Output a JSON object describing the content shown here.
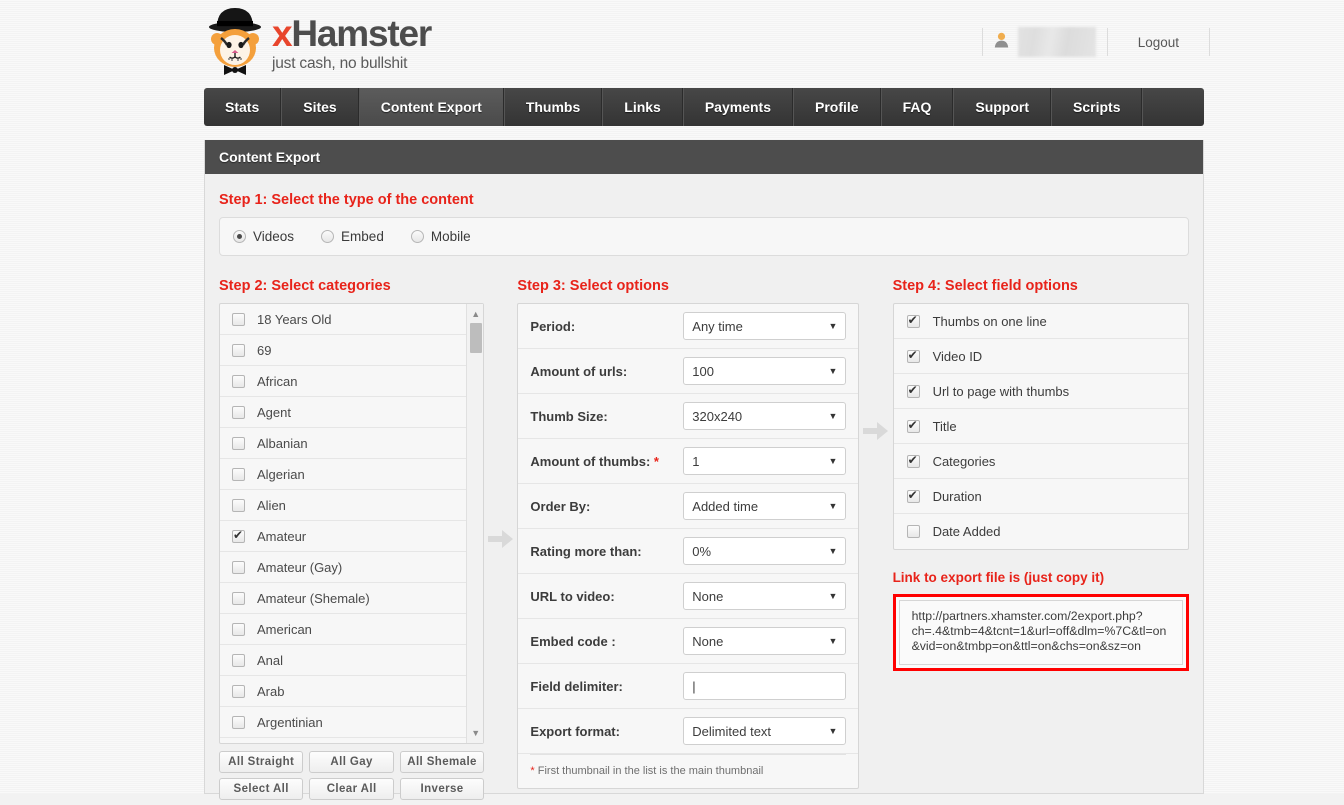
{
  "brand": {
    "name_x": "x",
    "name_rest": "Hamster",
    "tagline": "just cash, no bullshit",
    "logo_icon": "hamster-in-tophat-icon",
    "accent_color": "#e8452c"
  },
  "header": {
    "user_icon": "user-avatar-icon",
    "username": "",
    "logout_label": "Logout"
  },
  "nav": {
    "items": [
      {
        "label": "Stats",
        "active": false
      },
      {
        "label": "Sites",
        "active": false
      },
      {
        "label": "Content Export",
        "active": true
      },
      {
        "label": "Thumbs",
        "active": false
      },
      {
        "label": "Links",
        "active": false
      },
      {
        "label": "Payments",
        "active": false
      },
      {
        "label": "Profile",
        "active": false
      },
      {
        "label": "FAQ",
        "active": false
      },
      {
        "label": "Support",
        "active": false
      },
      {
        "label": "Scripts",
        "active": false
      }
    ]
  },
  "panel": {
    "title": "Content Export"
  },
  "step1": {
    "label": "Step 1:  Select the type of the content",
    "options": [
      {
        "label": "Videos",
        "checked": true
      },
      {
        "label": "Embed",
        "checked": false
      },
      {
        "label": "Mobile",
        "checked": false
      }
    ]
  },
  "step2": {
    "label": "Step 2:  Select categories",
    "categories": [
      {
        "label": "18 Years Old",
        "checked": false
      },
      {
        "label": "69",
        "checked": false
      },
      {
        "label": "African",
        "checked": false
      },
      {
        "label": "Agent",
        "checked": false
      },
      {
        "label": "Albanian",
        "checked": false
      },
      {
        "label": "Algerian",
        "checked": false
      },
      {
        "label": "Alien",
        "checked": false
      },
      {
        "label": "Amateur",
        "checked": true
      },
      {
        "label": "Amateur (Gay)",
        "checked": false
      },
      {
        "label": "Amateur (Shemale)",
        "checked": false
      },
      {
        "label": "American",
        "checked": false
      },
      {
        "label": "Anal",
        "checked": false
      },
      {
        "label": "Arab",
        "checked": false
      },
      {
        "label": "Argentinian",
        "checked": false
      }
    ],
    "buttons_row1": [
      "All Straight",
      "All Gay",
      "All Shemale"
    ],
    "buttons_row2": [
      "Select All",
      "Clear All",
      "Inverse"
    ],
    "scroll_up_icon": "scroll-up-arrow-icon",
    "scroll_down_icon": "scroll-down-arrow-icon"
  },
  "arrow_icon": "arrow-right-icon",
  "step3": {
    "label": "Step 3:  Select options",
    "rows": [
      {
        "label": "Period:",
        "value": "Any time",
        "type": "select",
        "required": false
      },
      {
        "label": "Amount of urls:",
        "value": "100",
        "type": "select",
        "required": false
      },
      {
        "label": "Thumb Size:",
        "value": "320x240",
        "type": "select",
        "required": false
      },
      {
        "label": "Amount of thumbs:",
        "value": "1",
        "type": "select",
        "required": true
      },
      {
        "label": "Order By:",
        "value": "Added time",
        "type": "select",
        "required": false
      },
      {
        "label": "Rating more than:",
        "value": "0%",
        "type": "select",
        "required": false
      },
      {
        "label": "URL to video:",
        "value": "None",
        "type": "select",
        "required": false
      },
      {
        "label": "Embed code :",
        "value": "None",
        "type": "select",
        "required": false
      },
      {
        "label": "Field delimiter:",
        "value": "|",
        "type": "text",
        "required": false
      },
      {
        "label": "Export format:",
        "value": "Delimited text",
        "type": "select",
        "required": false
      }
    ],
    "note_star": "*",
    "note": " First thumbnail in the list is the main thumbnail"
  },
  "step4": {
    "label": "Step 4:  Select field options",
    "fields": [
      {
        "label": "Thumbs on one line",
        "checked": true
      },
      {
        "label": "Video ID",
        "checked": true
      },
      {
        "label": "Url to page with thumbs",
        "checked": true
      },
      {
        "label": "Title",
        "checked": true
      },
      {
        "label": "Categories",
        "checked": true
      },
      {
        "label": "Duration",
        "checked": true
      },
      {
        "label": "Date Added",
        "checked": false
      }
    ],
    "link_title": "Link to export file is (just copy it)",
    "link_value": "http://partners.xhamster.com/2export.php?\nch=.4&tmb=4&tcnt=1&url=off&dlm=%7C&tl=on&vid=on&tmbp=on&ttl=on&chs=on&sz=on",
    "highlight_color": "#ff0000"
  }
}
